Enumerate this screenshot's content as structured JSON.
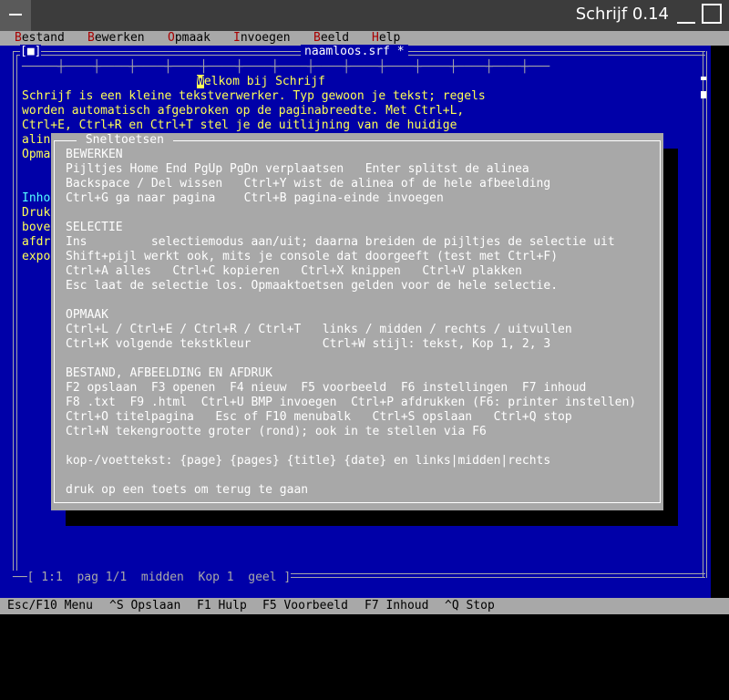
{
  "window": {
    "title": "Schrijf 0.14"
  },
  "menu": [
    {
      "hot": "B",
      "rest": "estand",
      "id": "bestand"
    },
    {
      "hot": "B",
      "rest": "ewerken",
      "id": "bewerken"
    },
    {
      "hot": "O",
      "rest": "pmaak",
      "id": "opmaak"
    },
    {
      "hot": "I",
      "rest": "nvoegen",
      "id": "invoegen"
    },
    {
      "hot": "B",
      "rest": "eeld",
      "id": "beeld"
    },
    {
      "hot": "H",
      "rest": "elp",
      "id": "help"
    }
  ],
  "editor": {
    "close_tag": "[■]",
    "doc_title": "naamloos.srf *",
    "ruler": "─────┼────┼────┼────┼────┼────┼────┼────┼────┼────┼────┼────┼────┼────┼───",
    "title_cursor_char": "W",
    "title_rest": "elkom bij Schrijf",
    "lines": [
      "Schrijf is een kleine tekstverwerker. Typ gewoon je tekst; regels",
      "worden automatisch afgebroken op de paginabreedte. Met Ctrl+L,",
      "Ctrl+E, Ctrl+R en Ctrl+T stel je de uitlijning van de huidige",
      "alin",
      "Opma"
    ],
    "lines2": [
      "Inho",
      "Druk",
      "bove",
      "afdr",
      "expo"
    ],
    "status": "[ 1:1  pag 1/1  midden  Kop 1  geel ]"
  },
  "hints": [
    "Esc/F10 Menu",
    "^S Opslaan",
    "F1 Hulp",
    "F5 Voorbeeld",
    "F7 Inhoud",
    "^Q Stop"
  ],
  "dialog": {
    "title": " Sneltoetsen ",
    "lines": [
      "BEWERKEN",
      "Pijltjes Home End PgUp PgDn verplaatsen   Enter splitst de alinea",
      "Backspace / Del wissen   Ctrl+Y wist de alinea of de hele afbeelding",
      "Ctrl+G ga naar pagina    Ctrl+B pagina-einde invoegen",
      "",
      "SELECTIE",
      "Ins         selectiemodus aan/uit; daarna breiden de pijltjes de selectie uit",
      "Shift+pijl werkt ook, mits je console dat doorgeeft (test met Ctrl+F)",
      "Ctrl+A alles   Ctrl+C kopieren   Ctrl+X knippen   Ctrl+V plakken",
      "Esc laat de selectie los. Opmaaktoetsen gelden voor de hele selectie.",
      "",
      "OPMAAK",
      "Ctrl+L / Ctrl+E / Ctrl+R / Ctrl+T   links / midden / rechts / uitvullen",
      "Ctrl+K volgende tekstkleur          Ctrl+W stijl: tekst, Kop 1, 2, 3",
      "",
      "BESTAND, AFBEELDING EN AFDRUK",
      "F2 opslaan  F3 openen  F4 nieuw  F5 voorbeeld  F6 instellingen  F7 inhoud",
      "F8 .txt  F9 .html  Ctrl+U BMP invoegen  Ctrl+P afdrukken (F6: printer instellen)",
      "Ctrl+O titelpagina   Esc of F10 menubalk   Ctrl+S opslaan   Ctrl+Q stop",
      "Ctrl+N tekengrootte groter (rond); ook in te stellen via F6",
      "",
      "kop-/voettekst: {page} {pages} {title} {date} en links|midden|rechts",
      "",
      "druk op een toets om terug te gaan"
    ]
  }
}
